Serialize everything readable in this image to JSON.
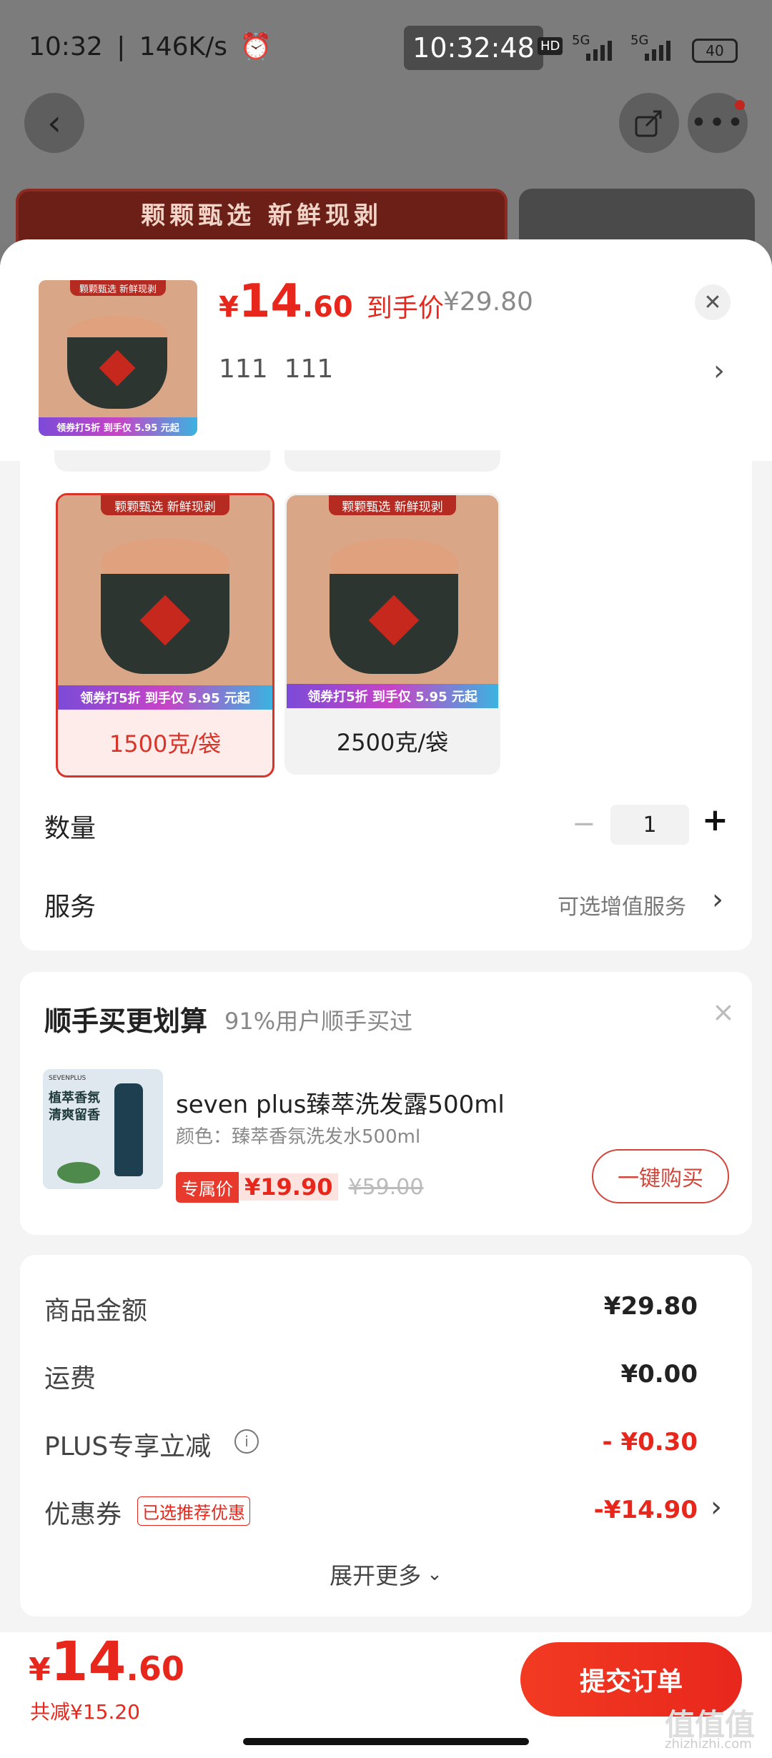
{
  "status": {
    "time": "10:32",
    "speed": "146K/s",
    "clock": "10:32:48",
    "battery": "40",
    "hd_label": "HD",
    "net1": "5G",
    "net2": "5G"
  },
  "background": {
    "banner_text": "颗颗甄选 新鲜现剥"
  },
  "header": {
    "currency": "¥",
    "price_int": "14",
    "price_dec": ".60",
    "price_tag": "到手价",
    "original_price": "¥29.80",
    "selected_spec": "111  111",
    "thumb_promo": "领券打5折 到手仅 5.95 元起",
    "thumb_band": "颗颗甄选 新鲜现剥"
  },
  "specs": {
    "options": [
      {
        "label": "1500克/袋",
        "selected": true,
        "promo": "领券打5折 到手仅 5.95 元起",
        "band": "颗颗甄选 新鲜现剥"
      },
      {
        "label": "2500克/袋",
        "selected": false,
        "promo": "领券打5折 到手仅 5.95 元起",
        "band": "颗颗甄选 新鲜现剥"
      }
    ]
  },
  "quantity": {
    "label": "数量",
    "minus": "−",
    "value": "1",
    "plus": "+"
  },
  "service": {
    "label": "服务",
    "value": "可选增值服务"
  },
  "addon": {
    "title": "顺手买更划算",
    "subtitle": "91%用户顺手买过",
    "close": "×",
    "product_name": "seven plus臻萃洗发露500ml",
    "product_attr": "颜色：臻萃香氛洗发水500ml",
    "badge": "专属价",
    "price": "¥19.90",
    "old_price": "¥59.00",
    "buy_button": "一键购买",
    "img_brand": "SEVENPLUS",
    "img_text1": "植萃香氛",
    "img_text2": "清爽留香"
  },
  "summary": {
    "rows": [
      {
        "label": "商品金额",
        "value": "¥29.80"
      },
      {
        "label": "运费",
        "value": "¥0.00"
      },
      {
        "label": "PLUS专享立减",
        "value": "- ¥0.30"
      },
      {
        "label": "优惠券",
        "value": "-¥14.90",
        "tag": "已选推荐优惠"
      }
    ],
    "expand": "展开更多"
  },
  "footer": {
    "currency": "¥",
    "price_int": "14",
    "price_dec": ".60",
    "saved": "共减¥15.20",
    "submit": "提交订单",
    "watermark": "值值值",
    "watermark_url": "zhizhizhi.com"
  },
  "colors": {
    "accent": "#e8271c",
    "sheet_bg": "#f4f4f4"
  }
}
